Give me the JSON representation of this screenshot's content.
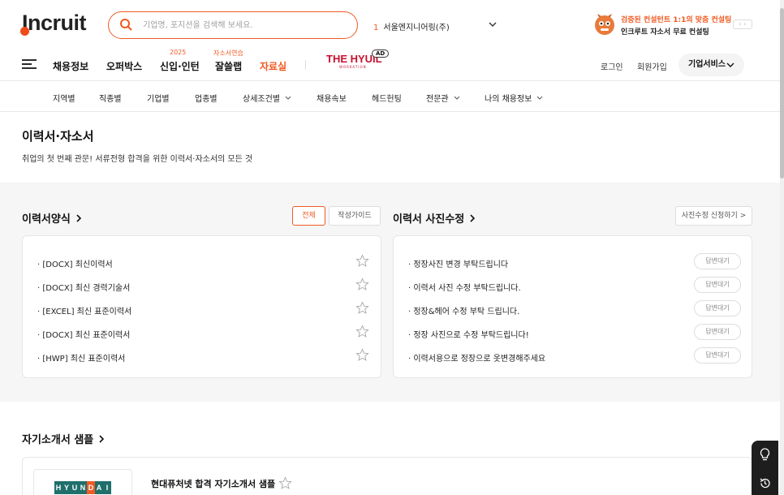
{
  "header": {
    "logo_text": "Incruit",
    "search_placeholder": "기업명, 포지션을 검색해 보세요.",
    "ranking_num": "1",
    "ranking_company": "서울엔지니어링(주)",
    "promo_line1": "검증된 컨설턴트 1:1의 맞춤 컨설팅",
    "promo_line2": "인크루트 자소서 무료 컨설팅",
    "promo_arrows": "‹ ›"
  },
  "nav": {
    "items": [
      {
        "label": "채용정보"
      },
      {
        "label": "오퍼박스"
      },
      {
        "label": "신입·인턴",
        "sup": "2025"
      },
      {
        "label": "잘쓸랩",
        "sup": "자소서연습"
      },
      {
        "label": "자료실"
      }
    ],
    "hyuil": "THE HYUIL",
    "hyuil_sub": "WORKATION",
    "ad": "AD",
    "login": "로그인",
    "join": "회원가입",
    "biz": "기업서비스"
  },
  "subnav": {
    "items": [
      "지역별",
      "직종별",
      "기업별",
      "업종별",
      "상세조건별",
      "채용속보",
      "헤드헌팅",
      "전문관",
      "나의 채용정보"
    ]
  },
  "page": {
    "title": "이력서·자소서",
    "desc": "취업의 첫 번째 관문! 서류전형 합격을 위한 이력서·자소서의 모든 것"
  },
  "resume": {
    "title": "이력서양식",
    "btn_all": "전체",
    "btn_guide": "작성가이드",
    "items": [
      "· [DOCX] 최신이력서",
      "· [DOCX] 최신 경력기술서",
      "· [EXCEL] 최신 표준이력서",
      "· [DOCX] 최신 표준이력서",
      "· [HWP] 최신 표준이력서"
    ]
  },
  "photo": {
    "title": "이력서 사진수정",
    "btn_apply": "사진수정 신청하기 >",
    "badge": "답변대기",
    "items": [
      "· 정장사진 변경 부탁드립니다",
      "· 이력서 사진 수정 부탁드립니다.",
      "· 정장&헤어 수정 부탁 드립니다.",
      "· 정장 사진으로 수정 부탁드립니다!",
      "· 이력서용으로 정장으로 옷변경해주세요"
    ]
  },
  "intro": {
    "title": "자기소개서 샘플",
    "logo_letters": [
      "H",
      "Y",
      "U",
      "N",
      "D",
      "A",
      "I"
    ],
    "item": "현대퓨처넷 합격 자기소개서 샘플"
  },
  "colors": {
    "accent": "#f05a23",
    "hyundai_green": "#1f6f6b",
    "hyundai_orange": "#f05a23"
  }
}
